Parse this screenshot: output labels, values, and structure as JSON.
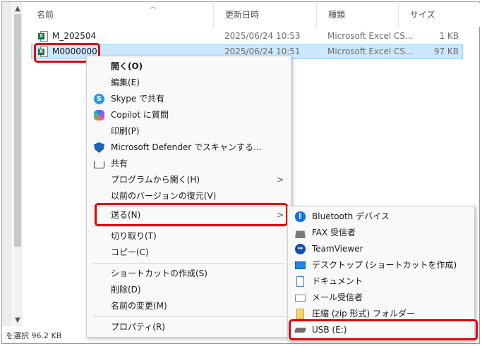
{
  "columns": {
    "name": "名前",
    "modified": "更新日時",
    "type": "種類",
    "size": "サイズ"
  },
  "files": [
    {
      "name": "M_202504",
      "modified": "2025/06/24 10:53",
      "type": "Microsoft Excel CS...",
      "size": "1 KB",
      "icon": "excel-csv-icon",
      "selected": false
    },
    {
      "name": "M0000000",
      "modified": "2025/06/24 10:51",
      "type": "Microsoft Excel CS...",
      "size": "97 KB",
      "icon": "excel-csv-icon",
      "selected": true
    }
  ],
  "status_text": "を選択  96.2 KB",
  "context_menu": {
    "items": [
      {
        "label": "開く(O)",
        "bold": true
      },
      {
        "label": "編集(E)"
      },
      {
        "label": "Skype で共有",
        "icon": "skype-icon"
      },
      {
        "label": "Copilot に質問",
        "icon": "copilot-icon"
      },
      {
        "label": "印刷(P)"
      },
      {
        "label": "Microsoft Defender でスキャンする...",
        "icon": "defender-shield-icon"
      },
      {
        "label": "共有",
        "icon": "share-icon"
      },
      {
        "label": "プログラムから開く(H)",
        "submenu": true
      },
      {
        "label": "以前のバージョンの復元(V)"
      },
      {
        "label": "送る(N)",
        "submenu": true,
        "highlighted": true
      },
      {
        "label": "切り取り(T)"
      },
      {
        "label": "コピー(C)"
      },
      {
        "label": "ショートカットの作成(S)"
      },
      {
        "label": "削除(D)"
      },
      {
        "label": "名前の変更(M)"
      },
      {
        "label": "プロパティ(R)"
      }
    ]
  },
  "send_to_menu": {
    "items": [
      {
        "label": "Bluetooth デバイス",
        "icon": "bluetooth-icon"
      },
      {
        "label": "FAX 受信者",
        "icon": "fax-icon"
      },
      {
        "label": "TeamViewer",
        "icon": "teamviewer-icon"
      },
      {
        "label": "デスクトップ (ショートカットを作成)",
        "icon": "desktop-icon"
      },
      {
        "label": "ドキュメント",
        "icon": "documents-icon"
      },
      {
        "label": "メール受信者",
        "icon": "mail-icon"
      },
      {
        "label": "圧縮 (zip 形式) フォルダー",
        "icon": "zip-folder-icon"
      },
      {
        "label": "USB (E:)",
        "icon": "usb-drive-icon",
        "highlighted": true
      }
    ]
  },
  "colors": {
    "highlight": "#e0000a",
    "selection": "#cce8ff",
    "excel_green": "#1d6f42"
  }
}
